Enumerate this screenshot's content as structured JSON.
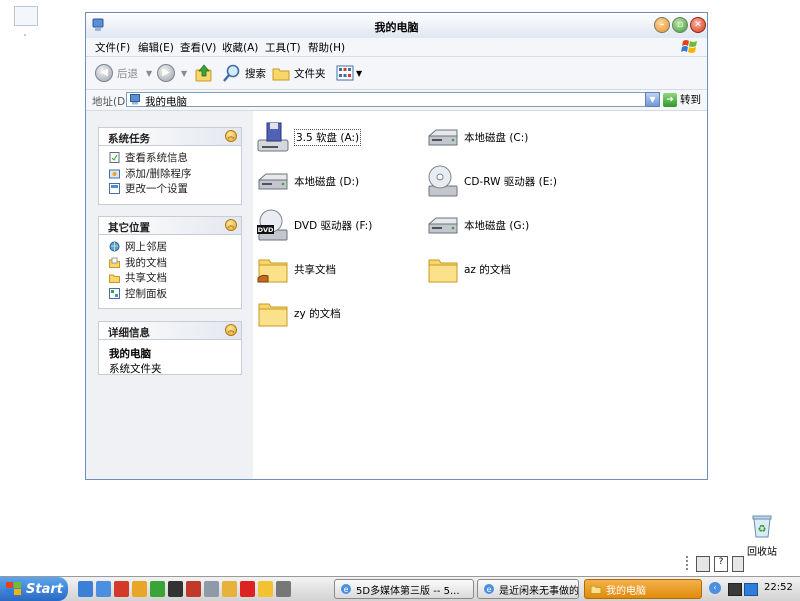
{
  "window": {
    "title": "我的电脑"
  },
  "menu": [
    "文件(F)",
    "编辑(E)",
    "查看(V)",
    "收藏(A)",
    "工具(T)",
    "帮助(H)"
  ],
  "toolbar": {
    "back": "后退",
    "search": "搜索",
    "folders": "文件夹"
  },
  "address": {
    "label": "地址(D)",
    "value": "我的电脑",
    "go": "转到"
  },
  "tasks": {
    "system": {
      "title": "系统任务",
      "items": [
        "查看系统信息",
        "添加/删除程序",
        "更改一个设置"
      ]
    },
    "places": {
      "title": "其它位置",
      "items": [
        "网上邻居",
        "我的文档",
        "共享文档",
        "控制面板"
      ]
    },
    "details": {
      "title": "详细信息",
      "name": "我的电脑",
      "type": "系统文件夹"
    }
  },
  "items": [
    {
      "label": "3.5 软盘 (A:)",
      "icon": "floppy-drive-icon"
    },
    {
      "label": "本地磁盘 (C:)",
      "icon": "hard-disk-icon"
    },
    {
      "label": "本地磁盘 (D:)",
      "icon": "hard-disk-icon"
    },
    {
      "label": "CD-RW 驱动器 (E:)",
      "icon": "cd-drive-icon"
    },
    {
      "label": "DVD 驱动器 (F:)",
      "icon": "dvd-drive-icon"
    },
    {
      "label": "本地磁盘 (G:)",
      "icon": "hard-disk-icon"
    },
    {
      "label": "共享文档",
      "icon": "shared-folder-icon"
    },
    {
      "label": "az 的文档",
      "icon": "folder-icon"
    },
    {
      "label": "zy 的文档",
      "icon": "folder-icon"
    }
  ],
  "desktop": {
    "recycle_bin": "回收站"
  },
  "taskbar": {
    "start": "Start",
    "tasks": [
      "5D多媒体第三版 -- 5...",
      "是近闲来无事做的...",
      "我的电脑"
    ],
    "clock": "22:52"
  },
  "colors": {
    "accent": "#2a69c4",
    "active_task": "#e08b0c"
  }
}
